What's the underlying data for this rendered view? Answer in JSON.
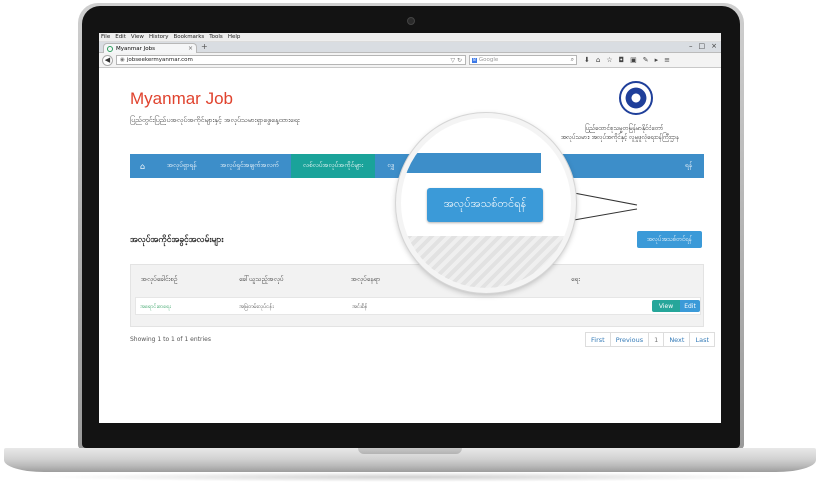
{
  "browser": {
    "menu": [
      "File",
      "Edit",
      "View",
      "History",
      "Bookmarks",
      "Tools",
      "Help"
    ],
    "tab_title": "Myanmar Jobs",
    "tab_close": "×",
    "new_tab": "+",
    "win_controls": [
      "–",
      "□",
      "×"
    ],
    "url": "jobseekermyanmar.com",
    "search_engine_badge": "8",
    "search_placeholder": "Google"
  },
  "site": {
    "title": "Myanmar Job",
    "subtitle": "ပြည်တွင်းပြည်ပအလုပ်အကိုင်များနှင့် အလုပ်သမားရှာဖွေနေ့ထားရေး",
    "org_line1": "ပြည်ထောင်စုသမ္မတမြန်မာနိုင်ငံတော်",
    "org_line2": "အလုပ်သမား၊ အလုပ်အကိုင်နှင့် လူမှုဖူလုံရေးဝန်ကြီးဌာန"
  },
  "nav": {
    "home_icon": "⌂",
    "items": [
      "အလုပ်ရှာရန်",
      "အလုပ်ရှင်အချက်အလက်",
      "လစ်လပ်အလုပ်အကိုင်များ",
      "လျှ",
      "ရန်"
    ]
  },
  "main": {
    "heading": "အလုပ်အကိုင်အခွင့်အလမ်းများ",
    "new_job_button": "အလုပ်အသစ်တင်ရန်",
    "columns": [
      "အလုပ်ခေါင်းစဉ်",
      "ခေါ်ယူသည့်အလုပ်",
      "အလုပ်နေရာ",
      "ရေး"
    ],
    "rows": [
      {
        "title": "အရောင်းစာရေး",
        "type": "အမြဲတမ်းလုပ်ငန်း",
        "location": "အင်းစိန်"
      }
    ],
    "view_label": "View",
    "edit_label": "Edit",
    "entries": "Showing 1 to 1 of 1 entries",
    "pager": {
      "first": "First",
      "previous": "Previous",
      "current": "1",
      "next": "Next",
      "last": "Last"
    }
  },
  "magnifier": {
    "button": "အလုပ်အသစ်တင်ရန်"
  },
  "colors": {
    "brand_title": "#e0432e",
    "nav_blue": "#3d8ec9",
    "nav_active": "#1aa39a",
    "button_blue": "#3b9ad8",
    "view_teal": "#26a69a"
  }
}
